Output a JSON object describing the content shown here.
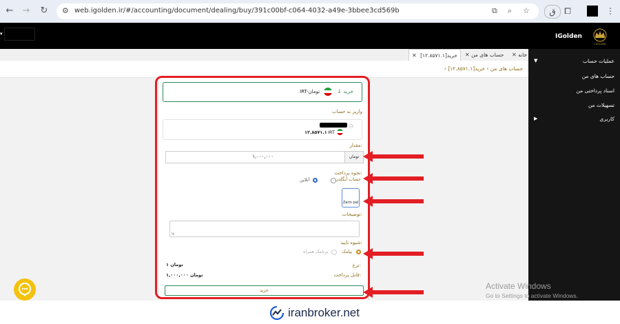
{
  "browser": {
    "url": "web.igolden.ir/#/accounting/document/dealing/buy/391c00bf-c064-4032-a49e-3bbee3cd569b",
    "profile_letter": "ق"
  },
  "app": {
    "brand": "IGolden",
    "logo_caption": "I GOLDEN"
  },
  "tabs": [
    {
      "label": "خانه"
    },
    {
      "label": "حساب های من"
    },
    {
      "label": "خرید[۱۲.۸۵۷۱.۱]"
    }
  ],
  "breadcrumb": "› حساب های من › خرید[۱۲.۸۵۷۱.۱]",
  "sidebar": {
    "section_account": "عملیات حساب",
    "items": [
      "حساب های من",
      "اسناد پرداختی من",
      "تسهیلات من"
    ],
    "section_user": "کاربری"
  },
  "form": {
    "buy_label": "خرید",
    "currency_label": "IRT-تومان",
    "deposit_to_label": "واریز به حساب",
    "account_number": "۱۲.۸۵۷۱.۱",
    "account_currency": "IRT",
    "amount_label": "مقدار:",
    "amount_unit": "تومان",
    "amount_value": "۱,۰۰۰,۰۰۰",
    "payment_method_label": "نحوه پرداخت:",
    "payment_option_account": "حساب آیگلدن",
    "payment_option_online": "آنلاین",
    "gateway_label": "Zarin pal",
    "description_label": "توضیحات:",
    "confirm_method_label": "شیوه تایید:",
    "confirm_option_sms": "پیامک",
    "confirm_option_app": "برنامک همراه",
    "rate_label": "نرخ:",
    "rate_value": "۱ تومان",
    "payable_label": "قابل پرداخت:",
    "payable_value": "۱,۰۰۰,۰۰۰ تومان",
    "submit_label": "خرید"
  },
  "watermark": {
    "line1": "Activate Windows",
    "line2": "Go to Settings to activate Windows."
  },
  "footer": {
    "site": "iranbroker.net"
  },
  "colors": {
    "accent_gold": "#8a6d1c",
    "sidebar_bg": "#151515",
    "highlight_red": "#e31e24",
    "buy_green": "#2e8b57"
  }
}
